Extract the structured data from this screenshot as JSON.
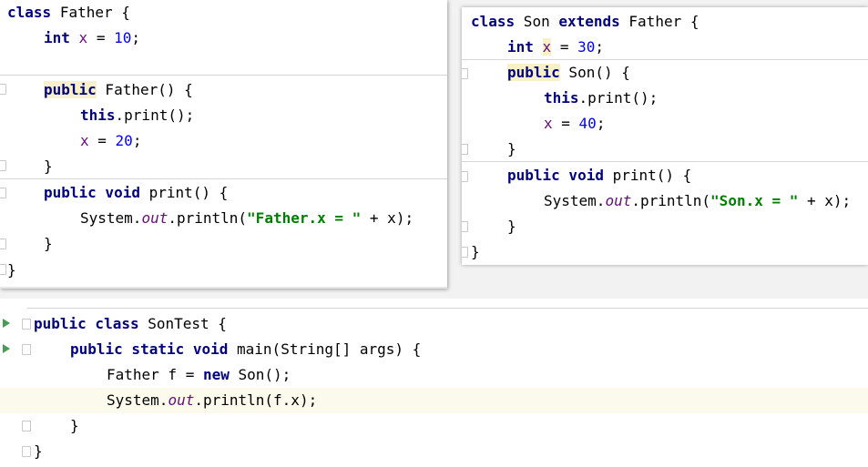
{
  "father": {
    "l1": [
      "class",
      "Father {"
    ],
    "l2": [
      "int",
      "x",
      " = ",
      "10",
      ";"
    ],
    "l3": [
      "public",
      " Father() {"
    ],
    "l4": [
      "this",
      ".print();"
    ],
    "l5": [
      "x",
      " = ",
      "20",
      ";"
    ],
    "l6": "}",
    "l7": [
      "public void",
      " print() {"
    ],
    "l8": [
      "System.",
      "out",
      ".println(",
      "\"Father.x = \"",
      " + x);"
    ],
    "l9": "}",
    "l10": "}"
  },
  "son": {
    "l1": [
      "class",
      " Son ",
      "extends",
      " Father {"
    ],
    "l2": [
      "int",
      "x",
      " = ",
      "30",
      ";"
    ],
    "l3": [
      "public",
      " Son() {"
    ],
    "l4": [
      "this",
      ".print();"
    ],
    "l5": [
      "x",
      " = ",
      "40",
      ";"
    ],
    "l6": "}",
    "l7": [
      "public void",
      " print() {"
    ],
    "l8": [
      "System.",
      "out",
      ".println(",
      "\"Son.x = \"",
      " + x);"
    ],
    "l9": "}",
    "l10": "}"
  },
  "test": {
    "l1": [
      "public class",
      " SonTest {"
    ],
    "l2": [
      "public static void",
      " main(String[] args) {"
    ],
    "l3": [
      "Father f = ",
      "new",
      " Son();"
    ],
    "l4": [
      "System.",
      "out",
      ".println(f.x);"
    ],
    "l5": "}",
    "l6": "}"
  },
  "colors": {
    "keyword": "#000080",
    "field": "#660e7a",
    "number": "#0000ff",
    "string": "#008000",
    "run": "#499c54"
  }
}
